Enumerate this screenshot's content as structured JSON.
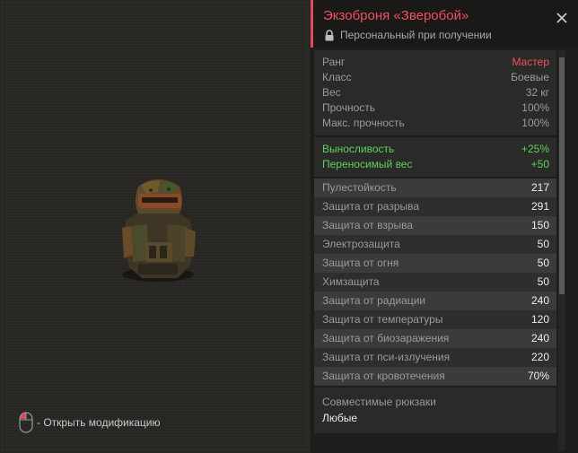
{
  "item": {
    "title": "Экзоброня «Зверобой»",
    "binding": "Персональный при получении"
  },
  "hint": {
    "text": "- Открыть модификацию",
    "icon": "mouse-icon"
  },
  "basic_stats": [
    {
      "label": "Ранг",
      "value": "Мастер"
    },
    {
      "label": "Класс",
      "value": "Боевые"
    },
    {
      "label": "Вес",
      "value": "32 кг"
    },
    {
      "label": "Прочность",
      "value": "100%"
    },
    {
      "label": "Макс. прочность",
      "value": "100%"
    }
  ],
  "bonuses": [
    {
      "label": "Выносливость",
      "value": "+25%"
    },
    {
      "label": "Переносимый вес",
      "value": "+50"
    }
  ],
  "protection": [
    {
      "label": "Пулестойкость",
      "value": "217"
    },
    {
      "label": "Защита от разрыва",
      "value": "291"
    },
    {
      "label": "Защита от взрыва",
      "value": "150"
    },
    {
      "label": "Электрозащита",
      "value": "50"
    },
    {
      "label": "Защита от огня",
      "value": "50"
    },
    {
      "label": "Химзащита",
      "value": "50"
    },
    {
      "label": "Защита от радиации",
      "value": "240"
    },
    {
      "label": "Защита от температуры",
      "value": "120"
    },
    {
      "label": "Защита от биозаражения",
      "value": "240"
    },
    {
      "label": "Защита от пси-излучения",
      "value": "220"
    },
    {
      "label": "Защита от кровотечения",
      "value": "70%"
    }
  ],
  "compatible": {
    "label": "Совместимые рюкзаки",
    "value": "Любые"
  },
  "colors": {
    "accent_red": "#f05060",
    "bonus_green": "#5ed15e"
  }
}
